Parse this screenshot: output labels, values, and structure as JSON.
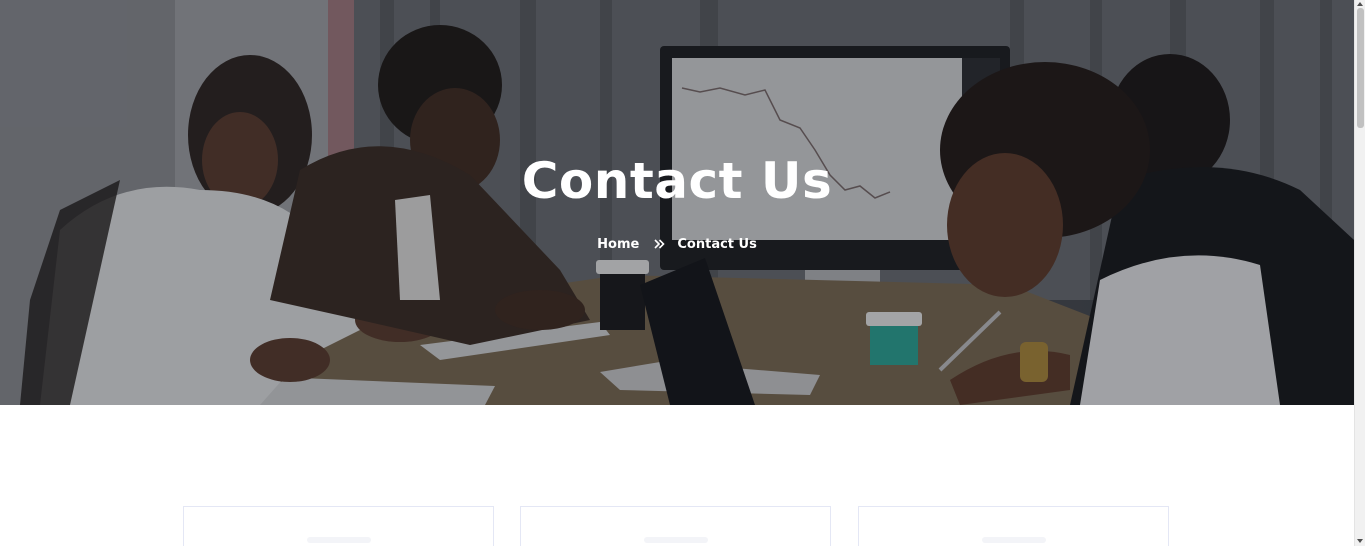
{
  "hero": {
    "title": "Contact Us",
    "breadcrumb": {
      "home_label": "Home",
      "separator_icon": "double-chevron-right-icon",
      "current_label": "Contact Us"
    }
  },
  "cards": [
    {
      "name": "contact-card-1"
    },
    {
      "name": "contact-card-2"
    },
    {
      "name": "contact-card-3"
    }
  ],
  "colors": {
    "hero_text": "#ffffff",
    "card_border": "#e4e7f5",
    "page_bg": "#ffffff"
  }
}
